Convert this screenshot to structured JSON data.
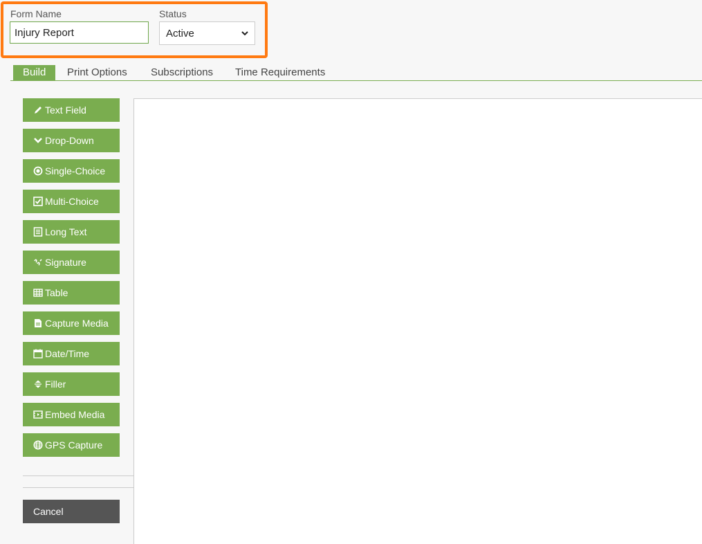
{
  "header": {
    "form_name_label": "Form Name",
    "form_name_value": "Injury Report",
    "status_label": "Status",
    "status_value": "Active"
  },
  "tabs": [
    {
      "label": "Build",
      "active": true
    },
    {
      "label": "Print Options",
      "active": false
    },
    {
      "label": "Subscriptions",
      "active": false
    },
    {
      "label": "Time Requirements",
      "active": false
    }
  ],
  "tools": [
    {
      "label": "Text Field",
      "icon": "pencil-icon"
    },
    {
      "label": "Drop-Down",
      "icon": "chevron-down-icon"
    },
    {
      "label": "Single-Choice",
      "icon": "radio-icon"
    },
    {
      "label": "Multi-Choice",
      "icon": "checkbox-icon"
    },
    {
      "label": "Long Text",
      "icon": "document-lines-icon"
    },
    {
      "label": "Signature",
      "icon": "signature-icon"
    },
    {
      "label": "Table",
      "icon": "table-icon"
    },
    {
      "label": "Capture Media",
      "icon": "file-icon"
    },
    {
      "label": "Date/Time",
      "icon": "calendar-icon"
    },
    {
      "label": "Filler",
      "icon": "vertical-resize-icon"
    },
    {
      "label": "Embed Media",
      "icon": "film-icon"
    },
    {
      "label": "GPS Capture",
      "icon": "globe-icon"
    }
  ],
  "cancel_label": "Cancel",
  "colors": {
    "accent": "#7aad4f",
    "highlight": "#ff7a12",
    "cancel": "#555555"
  }
}
